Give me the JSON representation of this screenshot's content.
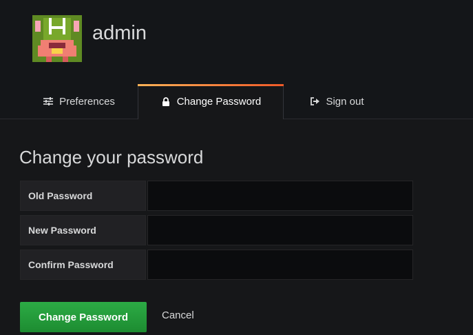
{
  "header": {
    "username": "admin",
    "avatar_icon": "pixel-monster-avatar"
  },
  "tabs": [
    {
      "label": "Preferences",
      "icon": "sliders-icon",
      "active": false
    },
    {
      "label": "Change Password",
      "icon": "lock-icon",
      "active": true
    },
    {
      "label": "Sign out",
      "icon": "sign-out-icon",
      "active": false
    }
  ],
  "form": {
    "title": "Change your password",
    "fields": [
      {
        "label": "Old Password",
        "value": ""
      },
      {
        "label": "New Password",
        "value": ""
      },
      {
        "label": "Confirm Password",
        "value": ""
      }
    ],
    "submit_label": "Change Password",
    "cancel_label": "Cancel"
  },
  "colors": {
    "background": "#161719",
    "header_background": "#141619",
    "label_background": "#212124",
    "input_background": "#0b0c0e",
    "accent_gradient_start": "#ffb357",
    "accent_gradient_end": "#f05a28",
    "primary_button": "#299c46",
    "text": "#d8d9da"
  }
}
